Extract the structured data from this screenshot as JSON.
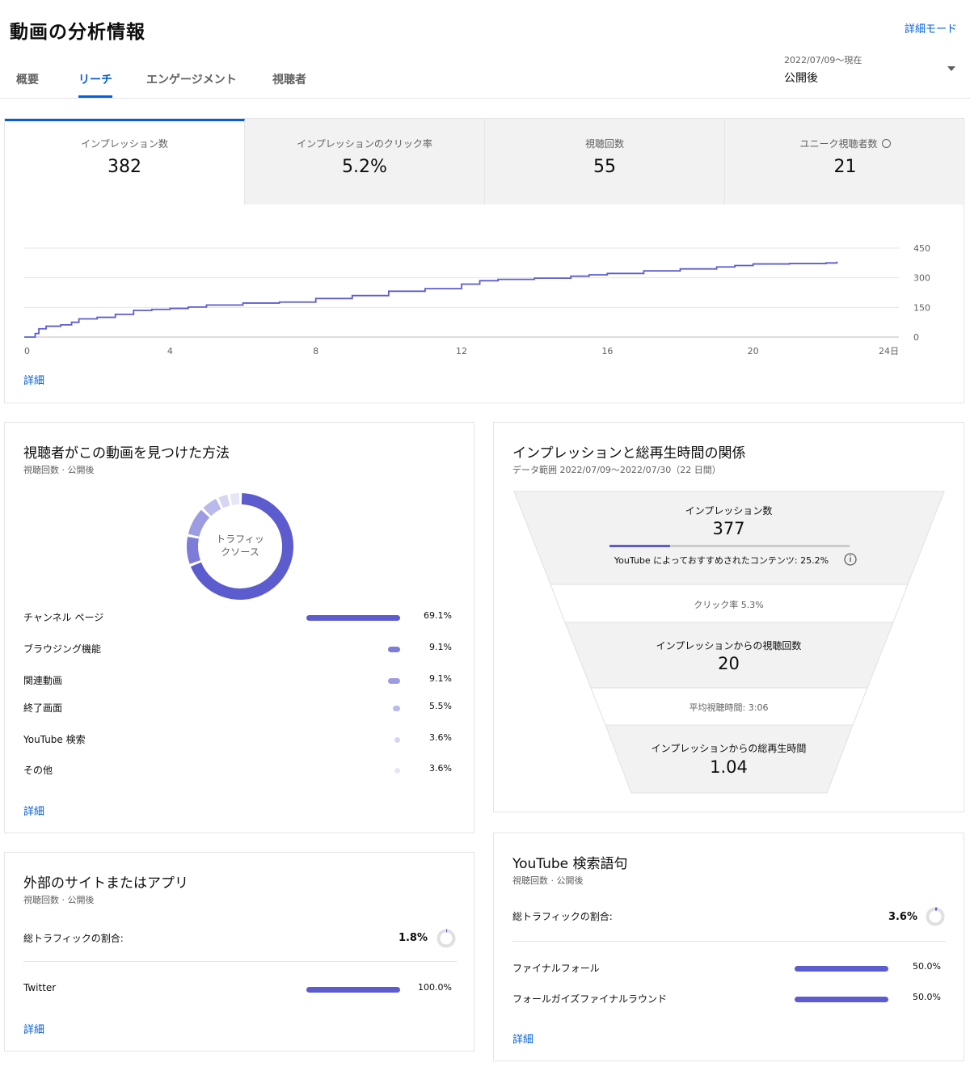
{
  "header": {
    "title": "動画の分析情報",
    "advanced_mode": "詳細モード",
    "date_range": "2022/07/09～現在",
    "date_label": "公開後"
  },
  "tabs": [
    {
      "label": "概要"
    },
    {
      "label": "リーチ"
    },
    {
      "label": "エンゲージメント"
    },
    {
      "label": "視聴者"
    }
  ],
  "metrics": [
    {
      "label": "インプレッション数",
      "value": "382"
    },
    {
      "label": "インプレッションのクリック率",
      "value": "5.2%"
    },
    {
      "label": "視聴回数",
      "value": "55"
    },
    {
      "label": "ユニーク視聴者数",
      "value": "21"
    }
  ],
  "main_chart": {
    "details": "詳細",
    "chart_data": {
      "type": "line",
      "x_ticks": [
        "0",
        "4",
        "8",
        "12",
        "16",
        "20",
        "24日"
      ],
      "y_ticks": [
        "0",
        "150",
        "300",
        "450"
      ],
      "ylim": [
        0,
        450
      ],
      "xlim": [
        0,
        24
      ],
      "grid": true,
      "color": "#5c5ccf",
      "series": [
        {
          "x": [
            0,
            0.3,
            0.4,
            0.6,
            1.0,
            1.3,
            1.5,
            2.0,
            2.5,
            3.0,
            3.5,
            4.0,
            4.5,
            5.0,
            6.0,
            7.0,
            8.0,
            9.0,
            10.0,
            11.0,
            12.0,
            12.5,
            13.0,
            14.0,
            15.0,
            15.5,
            16.0,
            17.0,
            18.0,
            19.0,
            19.5,
            20.0,
            21.0,
            22.0,
            22.3
          ],
          "y": [
            0,
            18,
            42,
            55,
            62,
            75,
            92,
            100,
            115,
            135,
            140,
            145,
            152,
            162,
            172,
            177,
            195,
            210,
            232,
            245,
            268,
            285,
            292,
            298,
            308,
            315,
            322,
            335,
            345,
            355,
            362,
            370,
            372,
            375,
            382
          ]
        }
      ]
    }
  },
  "traffic": {
    "title": "視聴者がこの動画を見つけた方法",
    "subtitle": "視聴回数 · 公開後",
    "donut_label": "トラフィッ\nクソース",
    "donut_label_1": "トラフィッ",
    "donut_label_2": "クソース",
    "details": "詳細",
    "chart_data": {
      "type": "pie",
      "categories": [
        "チャンネル ページ",
        "ブラウジング機能",
        "関連動画",
        "終了画面",
        "YouTube 検索",
        "その他"
      ],
      "values": [
        69.1,
        9.1,
        9.1,
        5.5,
        3.6,
        3.6
      ],
      "colors": [
        "#5c5ccf",
        "#7d7dd9",
        "#9c9ce2",
        "#b9b9ec",
        "#d6d6f4",
        "#e6e6f6"
      ]
    },
    "rows": [
      {
        "label": "チャンネル ページ",
        "pct": "69.1%"
      },
      {
        "label": "ブラウジング機能",
        "pct": "9.1%"
      },
      {
        "label": "関連動画",
        "pct": "9.1%"
      },
      {
        "label": "終了画面",
        "pct": "5.5%"
      },
      {
        "label": "YouTube 検索",
        "pct": "3.6%"
      },
      {
        "label": "その他",
        "pct": "3.6%"
      }
    ]
  },
  "funnel": {
    "title": "インプレッションと総再生時間の関係",
    "subtitle": "データ範囲 2022/07/09～2022/07/30（22 日間）",
    "impressions_label": "インプレッション数",
    "impressions_value": "377",
    "recommended_text": "YouTube によっておすすめされたコンテンツ: 25.2%",
    "recommended_fraction": 0.252,
    "ctr_text": "クリック率 5.3%",
    "views_label": "インプレッションからの視聴回数",
    "views_value": "20",
    "avg_text": "平均視聴時間: 3:06",
    "watch_label": "インプレッションからの総再生時間",
    "watch_value": "1.04"
  },
  "external": {
    "title": "外部のサイトまたはアプリ",
    "subtitle": "視聴回数 · 公開後",
    "share_label": "総トラフィックの割合:",
    "share_value": "1.8%",
    "share_fraction": 0.018,
    "details": "詳細",
    "rows": [
      {
        "label": "Twitter",
        "pct": "100.0%",
        "fraction": 1.0
      }
    ]
  },
  "search": {
    "title": "YouTube 検索語句",
    "subtitle": "視聴回数 · 公開後",
    "share_label": "総トラフィックの割合:",
    "share_value": "3.6%",
    "share_fraction": 0.036,
    "details": "詳細",
    "rows": [
      {
        "label": "ファイナルフォール",
        "pct": "50.0%",
        "fraction": 0.5
      },
      {
        "label": "フォールガイズファイナルラウンド",
        "pct": "50.0%",
        "fraction": 0.5
      }
    ]
  }
}
